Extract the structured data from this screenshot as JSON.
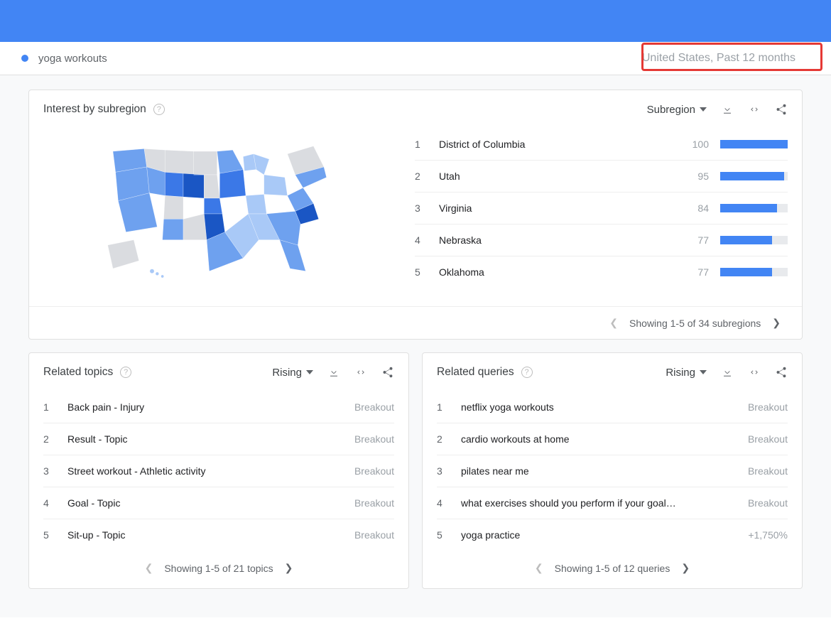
{
  "searchTerm": "yoga workouts",
  "filterSummary": "United States, Past 12 months",
  "interestCard": {
    "title": "Interest by subregion",
    "dropdown": "Subregion",
    "rows": [
      {
        "rank": "1",
        "name": "District of Columbia",
        "value": "100",
        "width": 100
      },
      {
        "rank": "2",
        "name": "Utah",
        "value": "95",
        "width": 95
      },
      {
        "rank": "3",
        "name": "Virginia",
        "value": "84",
        "width": 84
      },
      {
        "rank": "4",
        "name": "Nebraska",
        "value": "77",
        "width": 77
      },
      {
        "rank": "5",
        "name": "Oklahoma",
        "value": "77",
        "width": 77
      }
    ],
    "pager": "Showing 1-5 of 34 subregions"
  },
  "relatedTopics": {
    "title": "Related topics",
    "dropdown": "Rising",
    "rows": [
      {
        "rank": "1",
        "label": "Back pain - Injury",
        "value": "Breakout"
      },
      {
        "rank": "2",
        "label": "Result - Topic",
        "value": "Breakout"
      },
      {
        "rank": "3",
        "label": "Street workout - Athletic activity",
        "value": "Breakout"
      },
      {
        "rank": "4",
        "label": "Goal - Topic",
        "value": "Breakout"
      },
      {
        "rank": "5",
        "label": "Sit-up - Topic",
        "value": "Breakout"
      }
    ],
    "pager": "Showing 1-5 of 21 topics"
  },
  "relatedQueries": {
    "title": "Related queries",
    "dropdown": "Rising",
    "rows": [
      {
        "rank": "1",
        "label": "netflix yoga workouts",
        "value": "Breakout"
      },
      {
        "rank": "2",
        "label": "cardio workouts at home",
        "value": "Breakout"
      },
      {
        "rank": "3",
        "label": "pilates near me",
        "value": "Breakout"
      },
      {
        "rank": "4",
        "label": "what exercises should you perform if your goal…",
        "value": "Breakout"
      },
      {
        "rank": "5",
        "label": "yoga practice",
        "value": "+1,750%"
      }
    ],
    "pager": "Showing 1-5 of 12 queries"
  },
  "chart_data": [
    {
      "type": "bar",
      "title": "Interest by subregion",
      "categories": [
        "District of Columbia",
        "Utah",
        "Virginia",
        "Nebraska",
        "Oklahoma"
      ],
      "values": [
        100,
        95,
        84,
        77,
        77
      ],
      "xlabel": "",
      "ylabel": "Interest",
      "ylim": [
        0,
        100
      ]
    }
  ]
}
